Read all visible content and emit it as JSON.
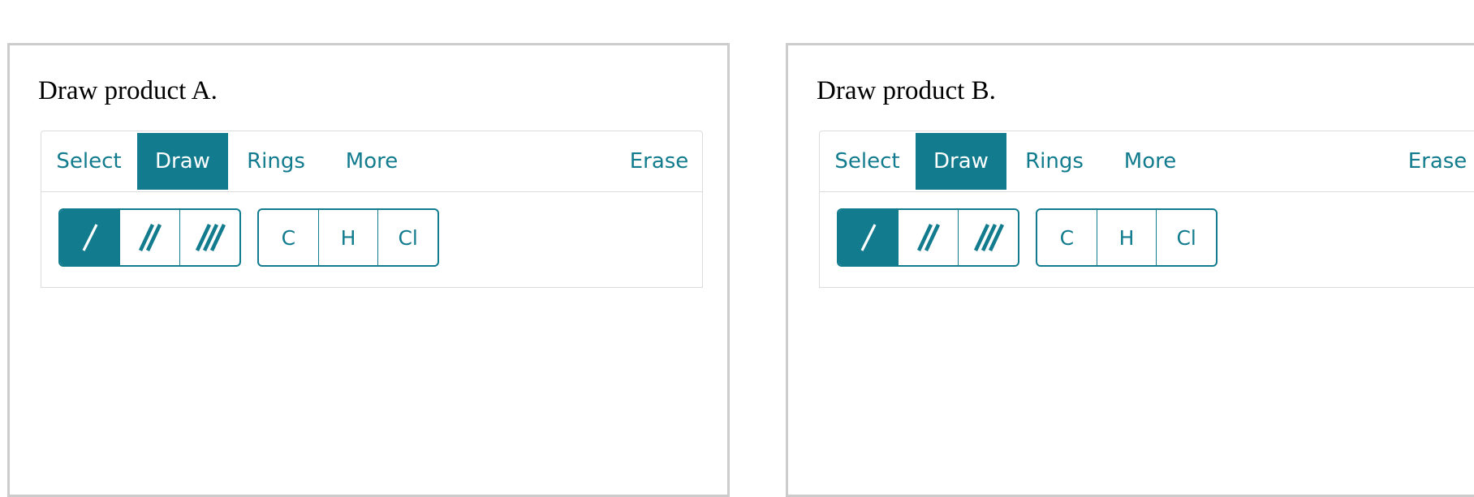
{
  "colors": {
    "accent": "#127c8e",
    "panel_border": "#cccccc",
    "toolbar_border": "#dcdcdc"
  },
  "panels": [
    {
      "prompt": "Draw product A.",
      "tabs": {
        "select": "Select",
        "draw": "Draw",
        "rings": "Rings",
        "more": "More",
        "erase": "Erase"
      },
      "active_tab": "Draw",
      "bond_tools": [
        "single-bond-icon",
        "double-bond-icon",
        "triple-bond-icon"
      ],
      "active_bond": "single-bond-icon",
      "atoms": [
        "C",
        "H",
        "Cl"
      ]
    },
    {
      "prompt": "Draw product B.",
      "tabs": {
        "select": "Select",
        "draw": "Draw",
        "rings": "Rings",
        "more": "More",
        "erase": "Erase"
      },
      "active_tab": "Draw",
      "bond_tools": [
        "single-bond-icon",
        "double-bond-icon",
        "triple-bond-icon"
      ],
      "active_bond": "single-bond-icon",
      "atoms": [
        "C",
        "H",
        "Cl"
      ]
    }
  ]
}
